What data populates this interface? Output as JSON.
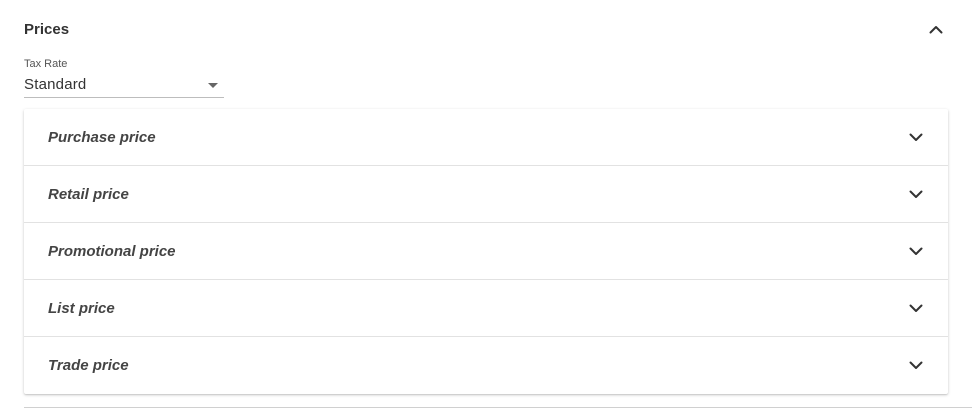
{
  "section": {
    "title": "Prices",
    "toggle_icon": "chevron-up-icon"
  },
  "tax_rate": {
    "label": "Tax Rate",
    "value": "Standard",
    "icon": "dropdown-caret-icon"
  },
  "price_rows": [
    {
      "label": "Purchase price",
      "icon": "chevron-down-icon"
    },
    {
      "label": "Retail price",
      "icon": "chevron-down-icon"
    },
    {
      "label": "Promotional price",
      "icon": "chevron-down-icon"
    },
    {
      "label": "List price",
      "icon": "chevron-down-icon"
    },
    {
      "label": "Trade price",
      "icon": "chevron-down-icon"
    }
  ]
}
